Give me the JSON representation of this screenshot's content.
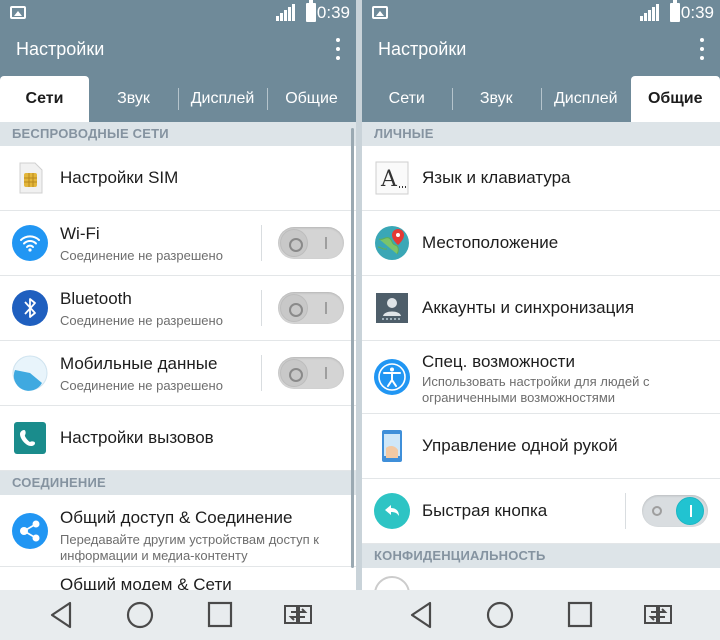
{
  "status": {
    "time": "0:39"
  },
  "left": {
    "title": "Настройки",
    "tabs": [
      {
        "label": "Сети",
        "active": true
      },
      {
        "label": "Звук",
        "active": false
      },
      {
        "label": "Дисплей",
        "active": false
      },
      {
        "label": "Общие",
        "active": false
      }
    ],
    "sections": {
      "wireless": "БЕСПРОВОДНЫЕ СЕТИ",
      "connection": "СОЕДИНЕНИЕ"
    },
    "items": [
      {
        "icon": "sim-card-icon",
        "label": "Настройки SIM"
      },
      {
        "icon": "wifi-icon",
        "label": "Wi-Fi",
        "sub": "Соединение не разрешено",
        "toggle": false
      },
      {
        "icon": "bluetooth-icon",
        "label": "Bluetooth",
        "sub": "Соединение не разрешено",
        "toggle": false
      },
      {
        "icon": "mobile-data-icon",
        "label": "Мобильные данные",
        "sub": "Соединение не разрешено",
        "toggle": false
      },
      {
        "icon": "phone-icon",
        "label": "Настройки вызовов"
      },
      {
        "icon": "share-icon",
        "label": "Общий доступ & Соединение",
        "sub": "Передавайте другим устройствам доступ к информации и медиа-контенту"
      },
      {
        "icon": "tethering-icon",
        "label": "Общий модем & Сети"
      }
    ]
  },
  "right": {
    "title": "Настройки",
    "tabs": [
      {
        "label": "Сети",
        "active": false
      },
      {
        "label": "Звук",
        "active": false
      },
      {
        "label": "Дисплей",
        "active": false
      },
      {
        "label": "Общие",
        "active": true
      }
    ],
    "sections": {
      "personal": "ЛИЧНЫЕ",
      "privacy": "КОНФИДЕНЦИАЛЬНОСТЬ"
    },
    "items": [
      {
        "icon": "language-icon",
        "label": "Язык и клавиатура"
      },
      {
        "icon": "location-icon",
        "label": "Местоположение"
      },
      {
        "icon": "accounts-icon",
        "label": "Аккаунты и синхронизация"
      },
      {
        "icon": "accessibility-icon",
        "label": "Спец. возможности",
        "sub": "Использовать настройки для людей с ограниченными возможностями"
      },
      {
        "icon": "one-hand-icon",
        "label": "Управление одной рукой"
      },
      {
        "icon": "quick-button-icon",
        "label": "Быстрая кнопка",
        "toggle": true
      }
    ]
  },
  "colors": {
    "accent": "#6f8a99",
    "toggle_on": "#21c3d1",
    "section_bg": "#dde4e8"
  }
}
